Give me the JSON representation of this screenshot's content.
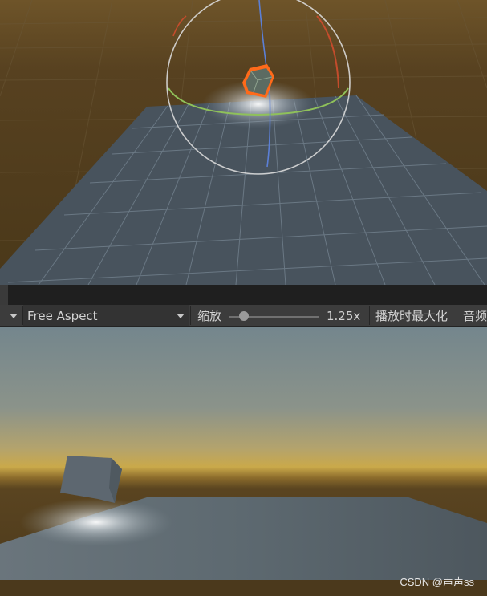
{
  "scene": {
    "colors": {
      "ground": "#4d3a1c",
      "horizon": "#6b5128",
      "plane": "#48535d",
      "selection": "#ff6a1a",
      "gizmo_y": "#5b7fd6",
      "gizmo_x": "#c44c2c",
      "gizmo_z": "#8fc15a"
    },
    "icons": [
      "rotate-gizmo-icon",
      "selected-cube-icon"
    ]
  },
  "toolbar": {
    "display_menu_icon": "chevron-down-icon",
    "aspect_label": "Free Aspect",
    "aspect_icon": "chevron-down-icon",
    "scale_label": "缩放",
    "scale_value": "1.25x",
    "maximize_label": "播放时最大化",
    "mute_label": "音频"
  },
  "game": {
    "colors": {
      "sky_top": "#74868d",
      "sky_horizon": "#c9a94a",
      "ground": "#4f3d1f",
      "plane": "#5a666e",
      "cube": "#5d6770"
    }
  },
  "watermark": "CSDN @声声ss"
}
